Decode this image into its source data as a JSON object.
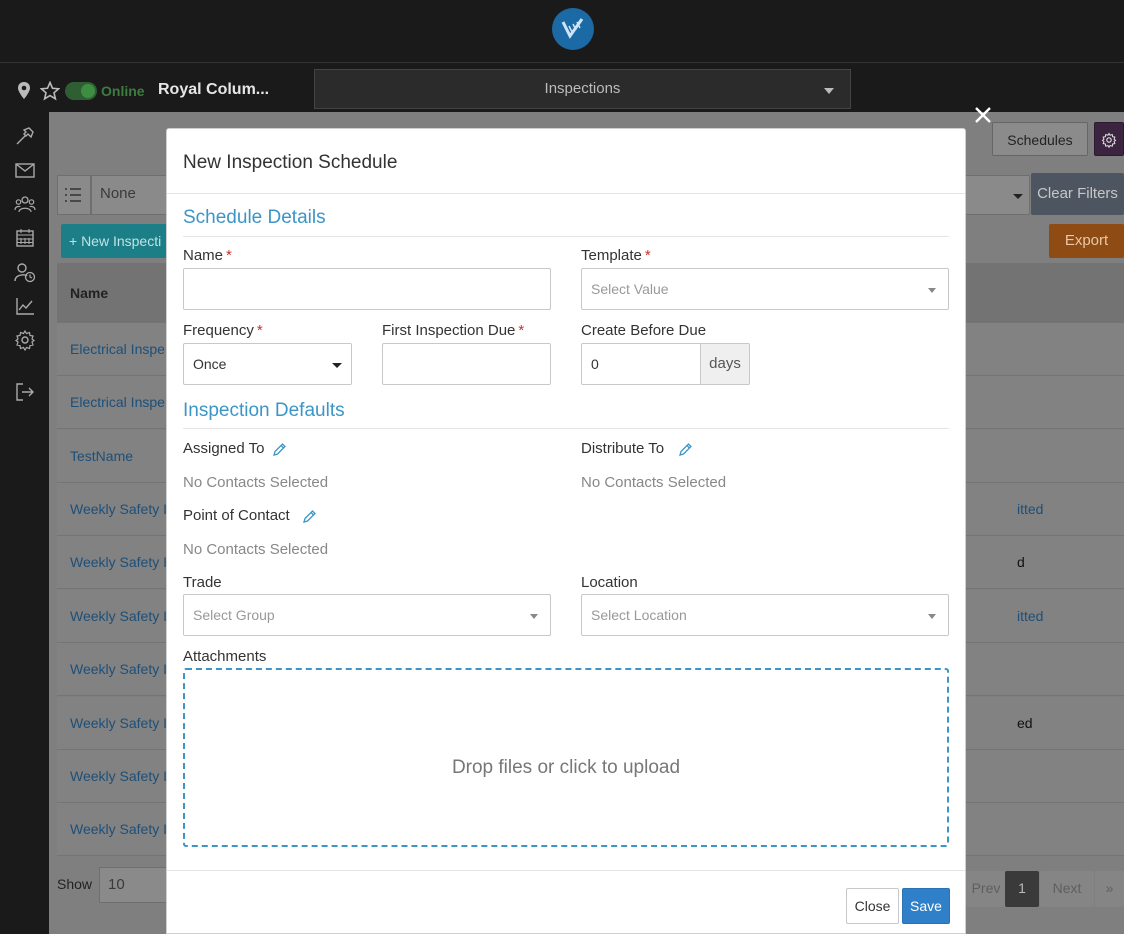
{
  "header": {
    "status": "Online",
    "project_name": "Royal Colum...",
    "module": "Inspections"
  },
  "background": {
    "schedules_label": "Schedules",
    "group_value": "None",
    "clear_filters_label": "Clear Filters",
    "new_button_label": "+ New Inspecti",
    "export_label": "Export",
    "table_header_name": "Name",
    "rows": [
      {
        "name": "Electrical Inspe",
        "status": ""
      },
      {
        "name": "Electrical Inspe",
        "status": ""
      },
      {
        "name": "TestName",
        "status": ""
      },
      {
        "name": "Weekly Safety I",
        "status": "itted"
      },
      {
        "name": "Weekly Safety I",
        "status": "d"
      },
      {
        "name": "Weekly Safety I",
        "status": "itted"
      },
      {
        "name": "Weekly Safety I",
        "status": ""
      },
      {
        "name": "Weekly Safety I",
        "status": "ed"
      },
      {
        "name": "Weekly Safety I",
        "status": ""
      },
      {
        "name": "Weekly Safety I",
        "status": ""
      }
    ],
    "show_label": "Show",
    "page_size": "10",
    "pagination": {
      "prev": "Prev",
      "current": "1",
      "next": "Next",
      "last": "»"
    }
  },
  "modal": {
    "title": "New Inspection Schedule",
    "schedule_details_title": "Schedule Details",
    "name_label": "Name",
    "name_value": "",
    "template_label": "Template",
    "template_placeholder": "Select Value",
    "frequency_label": "Frequency",
    "frequency_value": "Once",
    "first_due_label": "First Inspection Due",
    "first_due_value": "",
    "create_before_label": "Create Before Due",
    "create_before_value": "0",
    "create_before_unit": "days",
    "inspection_defaults_title": "Inspection Defaults",
    "assigned_to_label": "Assigned To",
    "assigned_to_value": "No Contacts Selected",
    "distribute_to_label": "Distribute To",
    "distribute_to_value": "No Contacts Selected",
    "point_of_contact_label": "Point of Contact",
    "point_of_contact_value": "No Contacts Selected",
    "trade_label": "Trade",
    "trade_placeholder": "Select Group",
    "location_label": "Location",
    "location_placeholder": "Select Location",
    "attachments_label": "Attachments",
    "dropzone_text": "Drop files or click to upload",
    "close_label": "Close",
    "save_label": "Save",
    "required_mark": "*"
  },
  "colors": {
    "accent": "#3b96c7",
    "primary_button": "#2f80c8",
    "required": "#c9302c",
    "online": "#3c7d3f"
  },
  "icons": [
    "logo-icon",
    "location-pin-icon",
    "star-icon",
    "caret-down-icon",
    "hammer-icon",
    "envelope-icon",
    "users-icon",
    "calendar-icon",
    "user-clock-icon",
    "chart-line-icon",
    "gear-icon",
    "sign-out-icon",
    "close-icon",
    "pencil-icon"
  ]
}
